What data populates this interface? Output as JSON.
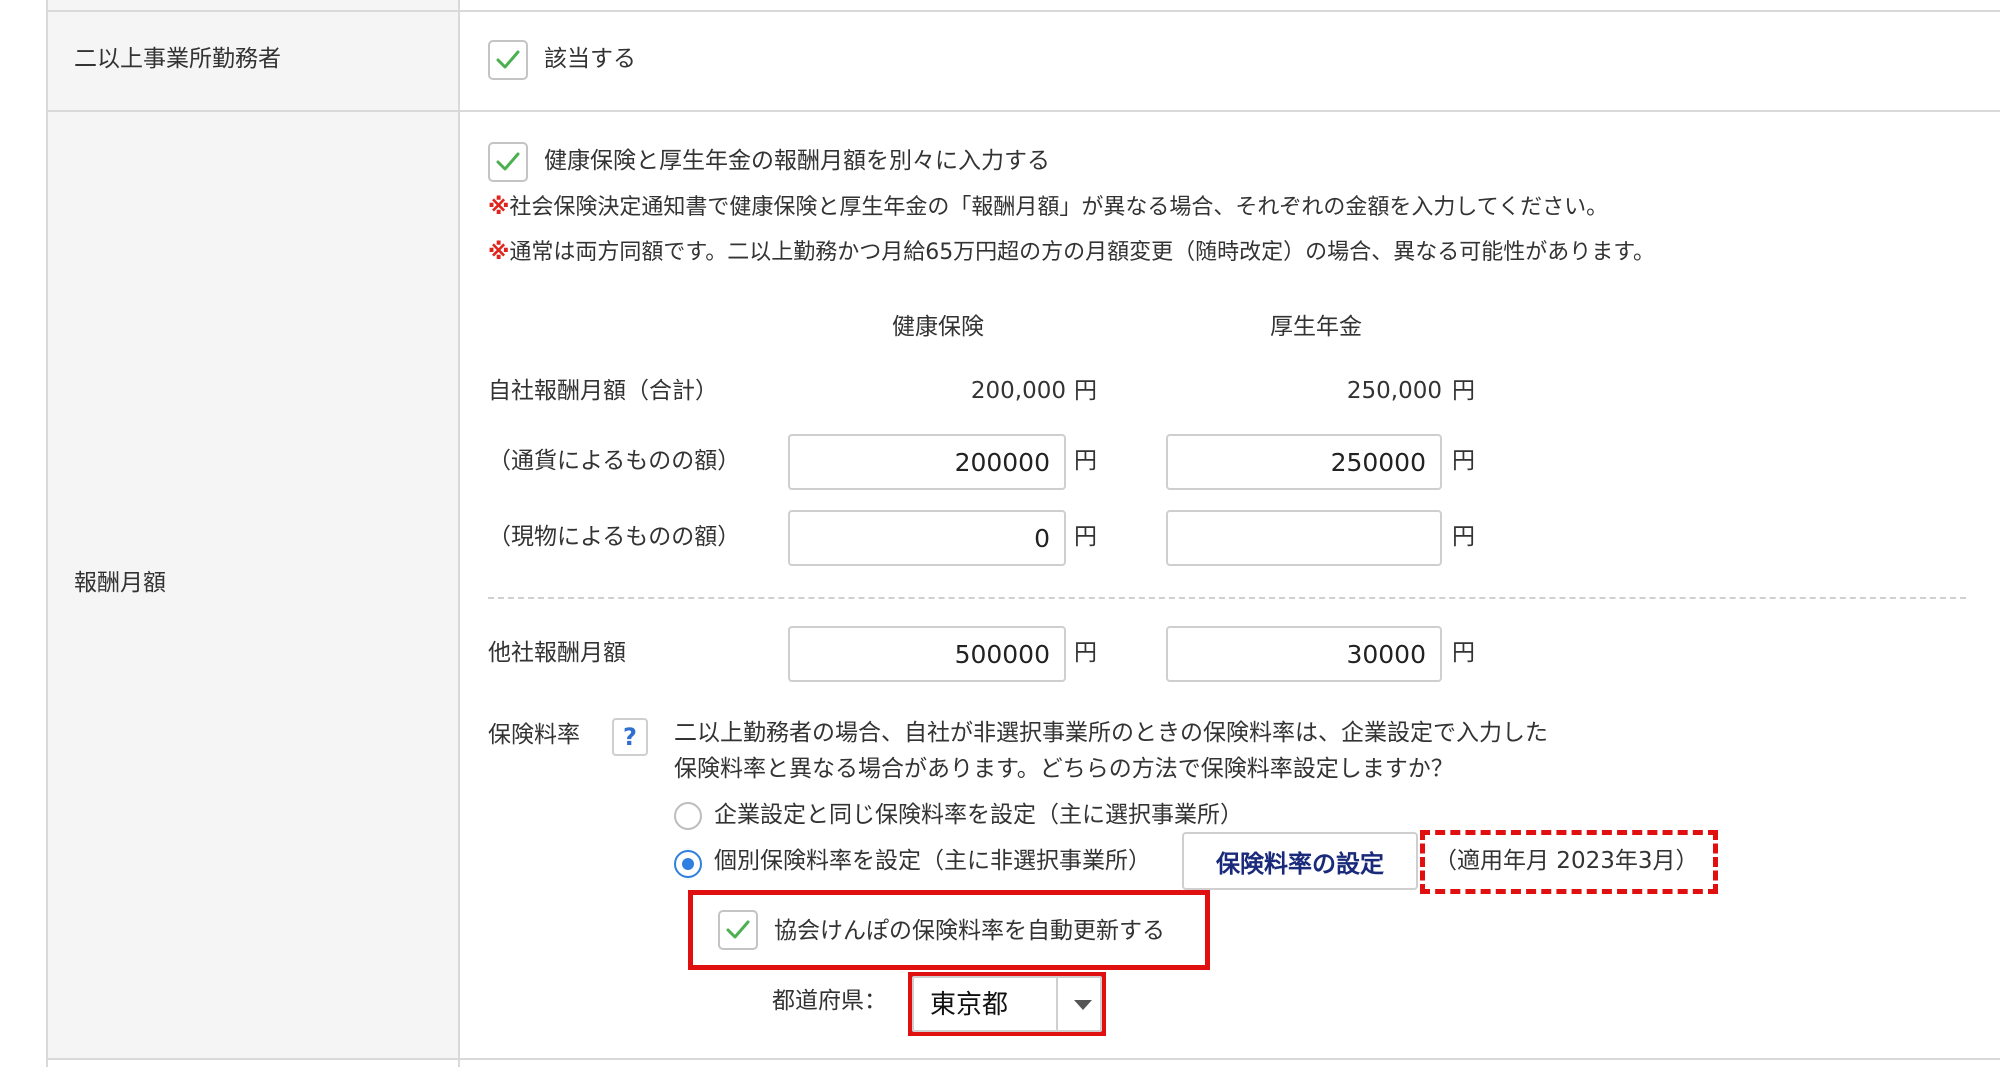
{
  "multi_office": {
    "label": "二以上事業所勤務者",
    "checkbox_label": "該当する",
    "checked": true
  },
  "salary": {
    "label": "報酬月額",
    "separate_checkbox_label": "健康保険と厚生年金の報酬月額を別々に入力する",
    "separate_checked": true,
    "notes": [
      {
        "mark": "※",
        "text": "社会保険決定通知書で健康保険と厚生年金の「報酬月額」が異なる場合、それぞれの金額を入力してください。"
      },
      {
        "mark": "※",
        "text": "通常は両方同額です。二以上勤務かつ月給65万円超の方の月額変更（随時改定）の場合、異なる可能性があります。"
      }
    ],
    "col_health": "健康保険",
    "col_pension": "厚生年金",
    "yen": "円",
    "rows": {
      "total": {
        "label": "自社報酬月額（合計）",
        "health": "200,000",
        "pension": "250,000"
      },
      "cash": {
        "label": "（通貨によるものの額）",
        "health": "200000",
        "pension": "250000"
      },
      "kind": {
        "label": "（現物によるものの額）",
        "health": "0",
        "pension": ""
      },
      "other": {
        "label": "他社報酬月額",
        "health": "500000",
        "pension": "30000"
      }
    }
  },
  "rate": {
    "label": "保険料率",
    "help_icon": "?",
    "description_line1": "二以上勤務者の場合、自社が非選択事業所のときの保険料率は、企業設定で入力した",
    "description_line2": "保険料率と異なる場合があります。どちらの方法で保険料率設定しますか？",
    "option_company": "企業設定と同じ保険料率を設定（主に選択事業所）",
    "option_individual": "個別保険料率を設定（主に非選択事業所）",
    "selected_option": "individual",
    "settings_button": "保険料率の設定",
    "applied_month": "（適用年月 2023年3月）",
    "auto_update_label": "協会けんぽの保険料率を自動更新する",
    "auto_update_checked": true,
    "prefecture_label": "都道府県：",
    "prefecture_value": "東京都"
  },
  "colors": {
    "accent_blue": "#2f7fe0",
    "check_green": "#4caf50",
    "highlight_red": "#e01010",
    "note_red": "#e0241b"
  }
}
